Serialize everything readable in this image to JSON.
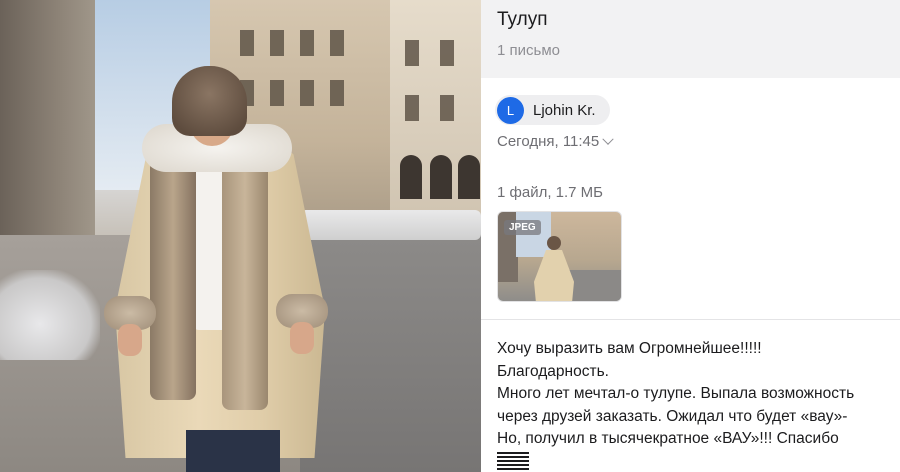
{
  "email": {
    "subject": "Тулуп",
    "message_count": "1 письмо",
    "sender": {
      "initial": "L",
      "name": "Ljohin Kr.",
      "avatar_color": "#1e6ae6"
    },
    "date": "Сегодня, 11:45",
    "attachments_summary": "1 файл, 1.7 МБ",
    "attachment": {
      "type_badge": "JPEG",
      "icon": "image-thumbnail"
    },
    "body_lines": [
      "Хочу выразить вам Огромнейшее!!!!!",
      "Благодарность.",
      "Много лет мечтал-о тулупе. Выпала возможность",
      "через друзей заказать. Ожидал что будет «вау»-",
      "Но, получил в тысячекратное «ВАУ»!!! Спасибо"
    ],
    "trailing_emoji": "flag-emoji"
  },
  "colors": {
    "header_band": "#f2f2f3",
    "secondary_text": "#8e8e93",
    "avatar": "#1e6ae6"
  }
}
